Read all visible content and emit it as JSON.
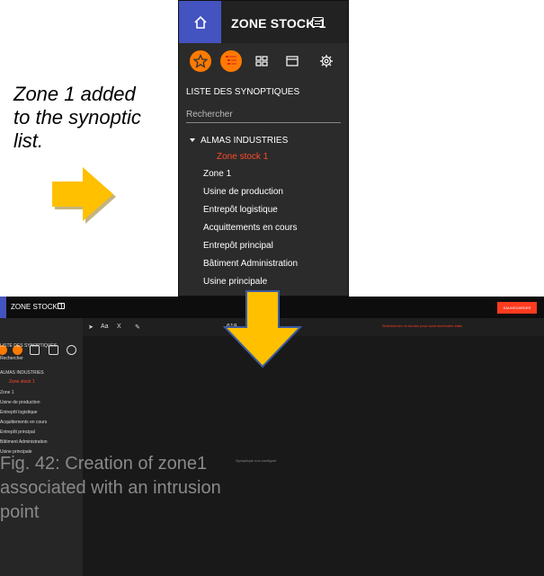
{
  "panel": {
    "title": "ZONE STOCK 1",
    "section_title": "LISTE DES SYNOPTIQUES",
    "search_placeholder": "Rechercher",
    "tree_root": "ALMAS INDUSTRIES",
    "tree_selected": "Zone stock 1",
    "tree_items": [
      "Zone 1",
      "Usine de production",
      "Entrepôt logistique",
      "Acquittements en cours",
      "Entrepôt principal",
      "Bâtiment Administration",
      "Usine principale"
    ],
    "icons": [
      "home-icon",
      "star-icon",
      "tree-list-icon",
      "grid-icon",
      "window-icon",
      "gear-icon"
    ],
    "colors": {
      "accent_blue": "#4353bf",
      "accent_orange": "#ff7a00",
      "selected_red": "#ff4a2a"
    }
  },
  "note": {
    "line1": "Zone 1 added",
    "line2": "to the synoptic",
    "line3": "list."
  },
  "app": {
    "title": "ZONE STOCK 1",
    "top_right_button": "SAUVEGARDER",
    "toolbar_hint": "Sélectionner un bouton pour avoir ses/toutes états",
    "canvas_hint": "Synoptique non configuré",
    "sidebar": {
      "section_title": "LISTE DES SYNOPTIQUES",
      "search_placeholder": "Rechercher",
      "tree_root": "ALMAS INDUSTRIES",
      "tree_selected": "Zone stock 1",
      "tree_items": [
        "Zone 1",
        "Usine de production",
        "Entrepôt logistique",
        "Acquittements en cours",
        "Entrepôt principal",
        "Bâtiment Administration",
        "Usine principale"
      ]
    },
    "toolstrip_labels": [
      "Aa",
      "X",
      "618"
    ]
  },
  "caption": {
    "line1": "Fig. 42: Creation of zone1",
    "line2": "associated with an intrusion",
    "line3": "point"
  }
}
